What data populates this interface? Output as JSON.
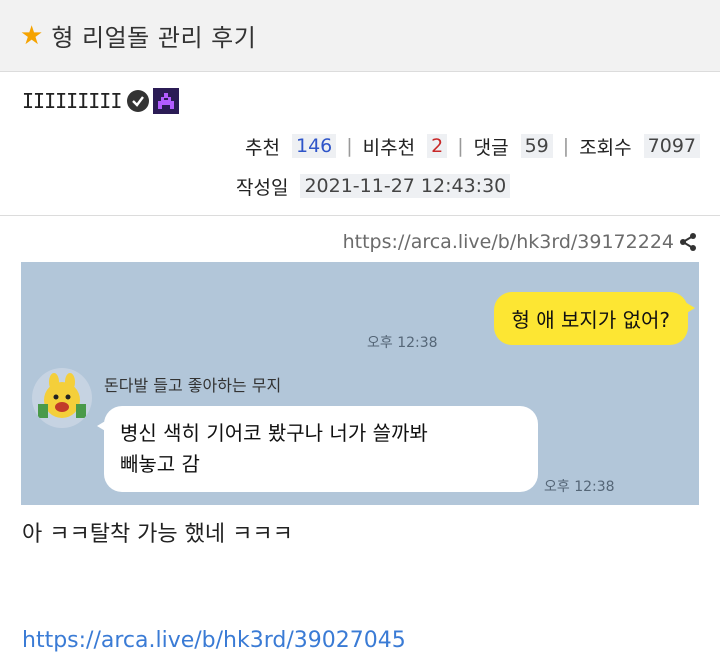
{
  "post": {
    "title": "형 리얼돌 관리 후기",
    "author": "IIIIIIIII",
    "stats": {
      "recommend_label": "추천",
      "recommend": "146",
      "not_recommend_label": "비추천",
      "not_recommend": "2",
      "comments_label": "댓글",
      "comments": "59",
      "views_label": "조회수",
      "views": "7097"
    },
    "date_label": "작성일",
    "date": "2021-11-27 12:43:30",
    "share_url": "https://arca.live/b/hk3rd/39172224"
  },
  "chat": {
    "my_message": "형 애 보지가 없어?",
    "my_time": "오후 12:38",
    "sender_name": "돈다발 들고 좋아하는 무지",
    "reply_line1": "병신 색히 기어코 봤구나 너가 쓸까봐",
    "reply_line2": "빼놓고 감",
    "reply_time": "오후 12:38"
  },
  "body": {
    "text": "아 ㅋㅋ탈착 가능 했네 ㅋㅋㅋ",
    "link": "https://arca.live/b/hk3rd/39027045"
  },
  "colors": {
    "accent_star": "#f5a300",
    "chat_bg": "#b2c6d9",
    "my_bubble": "#fde633",
    "link": "#3a7bd5"
  },
  "icons": [
    "star-icon",
    "verified-icon",
    "badge-icon",
    "share-icon"
  ]
}
